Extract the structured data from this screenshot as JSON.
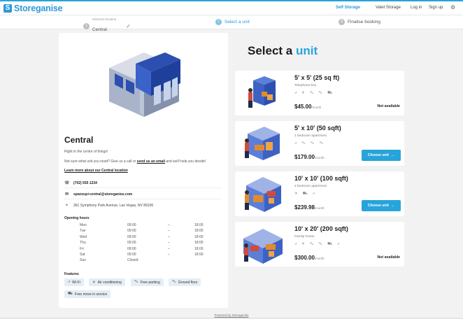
{
  "brand": {
    "name": "Storeganise",
    "mark": "S"
  },
  "nav": {
    "self_storage": "Self Storage",
    "valet_storage": "Valet Storage",
    "login": "Log in",
    "signup": "Sign up",
    "settings_icon": "gear-icon"
  },
  "steps": [
    {
      "num": "1",
      "sub": "Selected location",
      "label": "Central",
      "state": "done"
    },
    {
      "num": "2",
      "label": "Select a unit",
      "state": "active"
    },
    {
      "num": "3",
      "label": "Finalise booking",
      "state": "todo"
    }
  ],
  "location": {
    "name": "Central",
    "tagline": "Right in the centre of things!",
    "help_pre": "Not sure what unit you need? Give us a call or ",
    "help_link": "send us an email",
    "help_post": " and we'll help you decide!",
    "learn_more": "Learn more about our Central location",
    "phone": "(702) 555 1234",
    "email": "spaceup+central@storeganise.com",
    "address": "361 Symphony Park Avenue, Las Vegas, NV 89106"
  },
  "opening_hours": {
    "title": "Opening hours",
    "rows": [
      {
        "day": "Mon",
        "open": "09:00",
        "sep": "–",
        "close": "18:00"
      },
      {
        "day": "Tue",
        "open": "09:00",
        "sep": "–",
        "close": "18:00"
      },
      {
        "day": "Wed",
        "open": "09:00",
        "sep": "–",
        "close": "18:00"
      },
      {
        "day": "Thu",
        "open": "09:00",
        "sep": "–",
        "close": "18:00"
      },
      {
        "day": "Fri",
        "open": "09:00",
        "sep": "–",
        "close": "18:00"
      },
      {
        "day": "Sat",
        "open": "09:00",
        "sep": "–",
        "close": "18:00"
      },
      {
        "day": "Sun",
        "open": "Closed",
        "sep": "",
        "close": ""
      }
    ]
  },
  "features": {
    "title": "Features",
    "items": [
      {
        "icon": "wifi-icon",
        "label": "Wi-Fi"
      },
      {
        "icon": "snowflake-icon",
        "label": "Air conditioning"
      },
      {
        "icon": "car-icon",
        "label": "Free parking"
      },
      {
        "icon": "car-icon",
        "label": "Ground floor"
      },
      {
        "icon": "truck-icon",
        "label": "Free move in service"
      }
    ]
  },
  "select": {
    "prefix": "Select a ",
    "accent": "unit"
  },
  "units": [
    {
      "title": "5' x 5' (25 sq ft)",
      "subtitle": "Telephone box",
      "price": "$45.00",
      "per": "/month",
      "status": "Not available",
      "icon_count": 5
    },
    {
      "title": "5' x 10' (50 sqft)",
      "subtitle": "1 bedroom apartment",
      "price": "$179.00",
      "per": "/month",
      "action": "Choose unit",
      "icon_count": 4
    },
    {
      "title": "10' x 10' (100 sqft)",
      "subtitle": "2 bedroom apartment",
      "price": "$239.98",
      "per": "/month",
      "action": "Choose unit",
      "icon_count": 3
    },
    {
      "title": "10' x 20' (200 sqft)",
      "subtitle": "Family house",
      "price": "$300.00",
      "per": "/month",
      "status": "Not available",
      "icon_count": 6
    }
  ],
  "footer": {
    "powered": "Powered by Storeganise"
  },
  "colors": {
    "accent": "#27a4da",
    "brand": "#2b9ad8"
  }
}
